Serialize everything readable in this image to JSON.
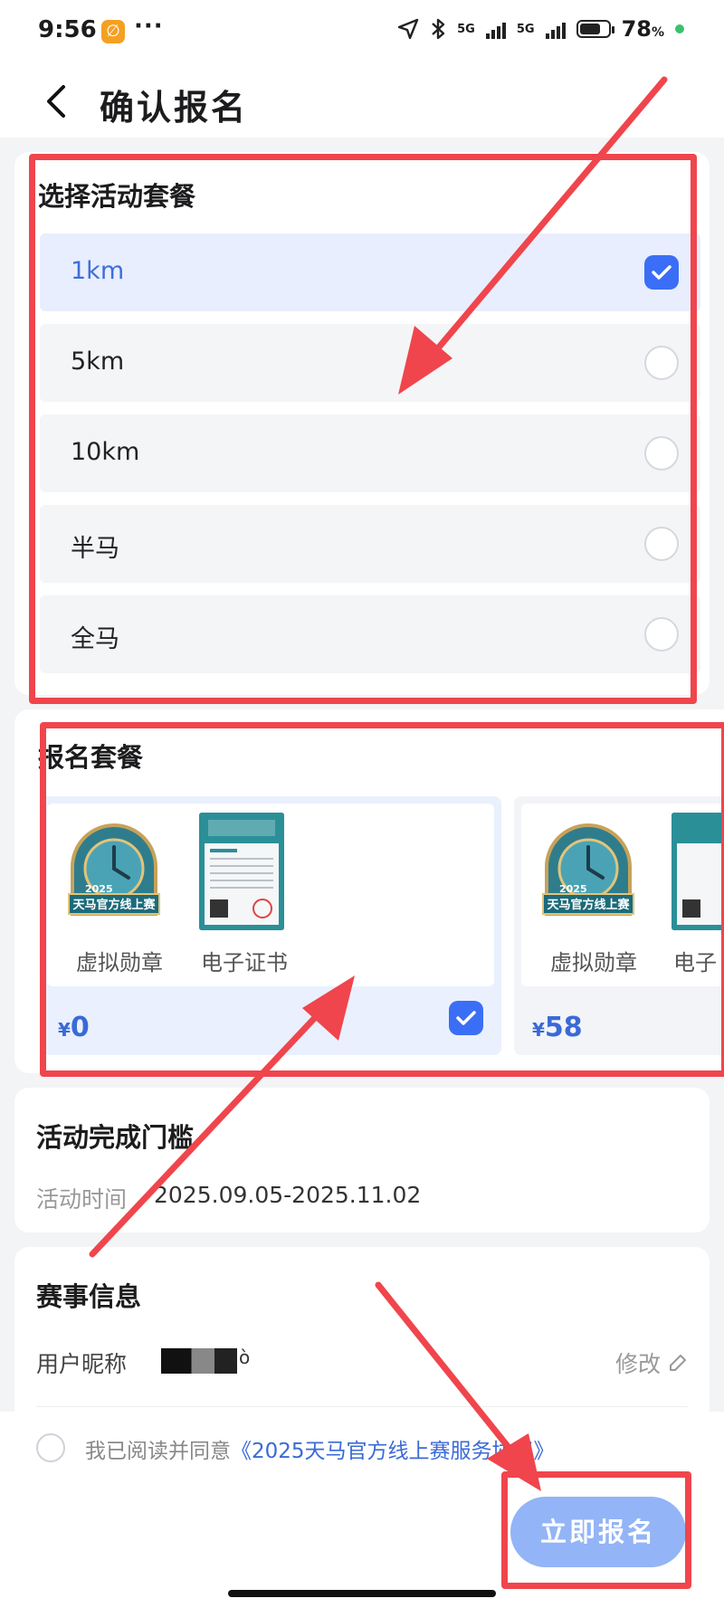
{
  "status_bar": {
    "time": "9:56",
    "app_icon_glyph": "∅",
    "more": "···",
    "network_label_1": "5G",
    "network_label_2": "5G",
    "battery_percent": "78",
    "battery_unit": "%",
    "battery_level": 0.78
  },
  "header": {
    "title": "确认报名"
  },
  "plan_section": {
    "title": "选择活动套餐",
    "options": [
      {
        "label": "1km",
        "selected": true
      },
      {
        "label": "5km",
        "selected": false
      },
      {
        "label": "10km",
        "selected": false
      },
      {
        "label": "半马",
        "selected": false
      },
      {
        "label": "全马",
        "selected": false
      }
    ]
  },
  "package_section": {
    "title": "报名套餐",
    "packages": [
      {
        "items": [
          {
            "caption": "虚拟勋章",
            "kind": "medal-icon"
          },
          {
            "caption": "电子证书",
            "kind": "certificate-icon"
          }
        ],
        "currency": "¥",
        "price": "0",
        "selected": true
      },
      {
        "items": [
          {
            "caption": "虚拟勋章",
            "kind": "medal-icon"
          },
          {
            "caption": "电子",
            "kind": "certificate-icon"
          }
        ],
        "currency": "¥",
        "price": "58",
        "selected": false
      }
    ]
  },
  "threshold_section": {
    "title": "活动完成门槛",
    "time_label": "活动时间",
    "time_value": "2025.09.05-2025.11.02"
  },
  "event_info_section": {
    "title": "赛事信息",
    "nickname_label": "用户昵称",
    "nickname_partial": "ò",
    "edit_label": "修改"
  },
  "footer": {
    "agree_prefix": "我已阅读并同意",
    "agree_link": "《2025天马官方线上赛服务协议》",
    "submit_label": "立即报名"
  },
  "medal_art": {
    "year": "2025",
    "banner": "天马官方线上赛"
  },
  "colors": {
    "accent": "#3b6ef6",
    "annotation": "#f0454c",
    "button": "#93b4f6"
  }
}
